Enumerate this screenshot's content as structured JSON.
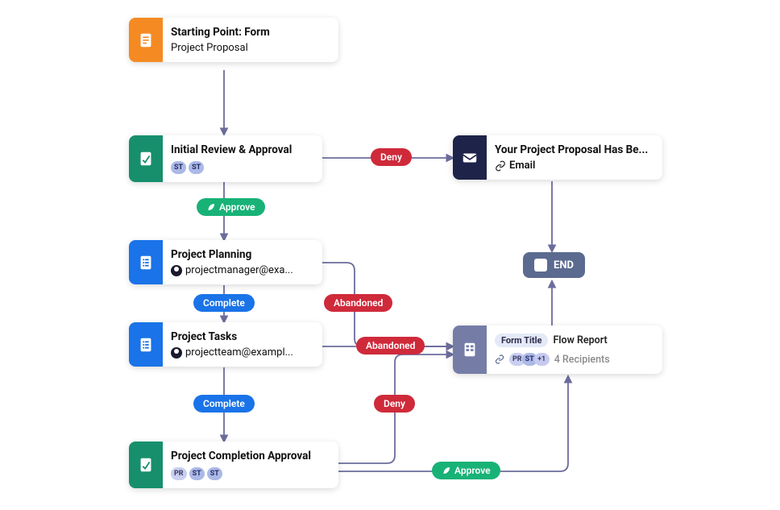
{
  "colors": {
    "orange": "#f58a23",
    "green": "#178f6d",
    "blue": "#1a73e8",
    "navy": "#1e2349",
    "slate": "#5b6a8f",
    "lilac": "#757da7",
    "line": "#6c6c9c"
  },
  "nodes": {
    "start": {
      "title": "Starting Point: Form",
      "subtitle": "Project Proposal"
    },
    "review": {
      "title": "Initial Review & Approval",
      "chips": [
        "ST",
        "ST"
      ]
    },
    "planning": {
      "title": "Project Planning",
      "assignee": "projectmanager@exa..."
    },
    "tasks": {
      "title": "Project Tasks",
      "assignee": "projectteam@exampl..."
    },
    "completion": {
      "title": "Project Completion Approval",
      "chips": [
        "PR",
        "ST",
        "ST"
      ]
    },
    "emailDenied": {
      "title": "Your Project Proposal Has Be...",
      "subtitle": "Email"
    },
    "flowReport": {
      "tag": "Form Title",
      "title": "Flow Report",
      "recip": "4 Recipients",
      "chips": [
        "PR",
        "ST",
        "+1"
      ]
    },
    "end": {
      "label": "END"
    }
  },
  "pills": {
    "approve": "Approve",
    "deny": "Deny",
    "complete": "Complete",
    "abandoned": "Abandoned"
  }
}
